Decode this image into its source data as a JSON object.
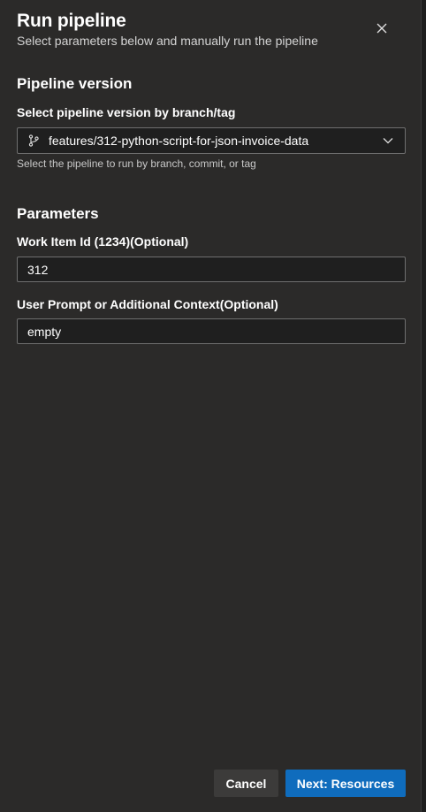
{
  "dialog": {
    "title": "Run pipeline",
    "subtitle": "Select parameters below and manually run the pipeline",
    "close_icon": "close-icon"
  },
  "pipeline_version": {
    "section_title": "Pipeline version",
    "branch_label": "Select pipeline version by branch/tag",
    "branch_icon": "git-branch-icon",
    "branch_value": "features/312-python-script-for-json-invoice-data",
    "helper_text": "Select the pipeline to run by branch, commit, or tag"
  },
  "parameters": {
    "section_title": "Parameters",
    "work_item_label": "Work Item Id (1234)(Optional)",
    "work_item_value": "312",
    "prompt_label": "User Prompt or Additional Context(Optional)",
    "prompt_value": "empty"
  },
  "footer": {
    "cancel_label": "Cancel",
    "next_label": "Next: Resources"
  },
  "colors": {
    "panel_bg": "#2b2a29",
    "input_bg": "#1f1f1f",
    "primary": "#0f6cbd"
  }
}
